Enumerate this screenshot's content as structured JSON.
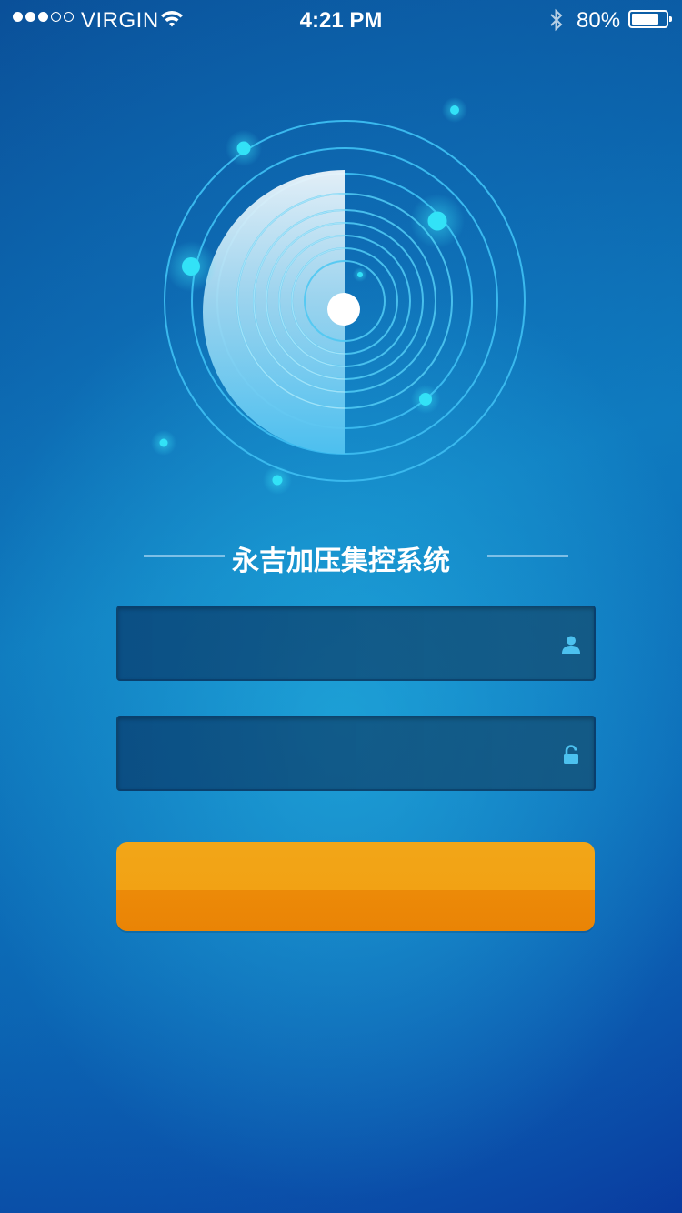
{
  "status_bar": {
    "signal_bars_filled": 3,
    "signal_bars_total": 5,
    "carrier": "VIRGIN",
    "time": "4:21 PM",
    "battery_percent": "80%",
    "battery_level": 0.8
  },
  "app": {
    "title": "永吉加压集控系统"
  },
  "login_form": {
    "username_value": "",
    "password_value": "",
    "username_icon": "user-icon",
    "password_icon": "lock-icon",
    "login_button_label": ""
  },
  "colors": {
    "accent_cyan": "#2fe0f5",
    "button_top": "#f2a618",
    "button_bottom": "#ec8a08",
    "field_icon": "#4cc1ef"
  }
}
